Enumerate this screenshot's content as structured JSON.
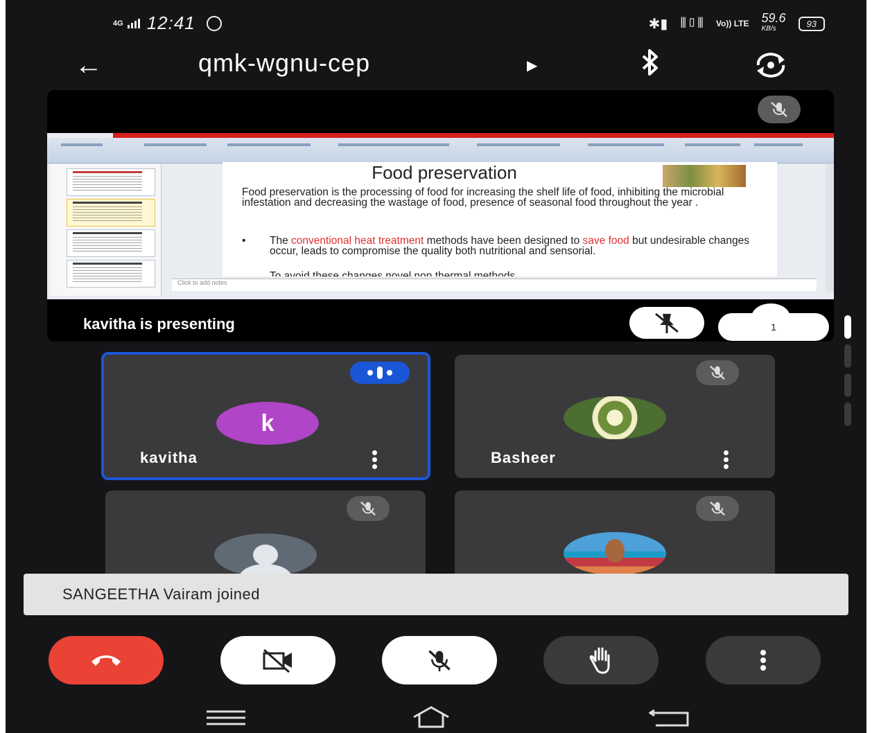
{
  "status_bar": {
    "network": "4G",
    "time": "12:41",
    "lte_label": "Vo)) LTE",
    "speed_value": "59.6",
    "speed_unit": "KB/s",
    "battery": "93"
  },
  "header": {
    "meeting_code": "qmk-wgnu-cep",
    "icons": [
      "back-arrow-icon",
      "play-arrow-icon",
      "bluetooth-icon",
      "switch-camera-icon"
    ]
  },
  "presentation": {
    "slide_title": "Food preservation",
    "slide_paragraph": "Food preservation is the processing of food for increasing the shelf life of food, inhibiting the microbial infestation and decreasing the wastage of food, presence of seasonal food throughout the year .",
    "bullet_pre": "The ",
    "bullet_hl1": "conventional heat treatment",
    "bullet_mid": " methods have been designed to ",
    "bullet_hl2": "save food",
    "bullet_post": " but undesirable changes occur, leads to compromise the quality both nutritional and sensorial.",
    "bullet_cutoff": "To avoid these changes novel non thermal methods",
    "notes_placeholder": "Click to add notes",
    "presenter_label": "kavitha is presenting",
    "participant_count": "1",
    "highlight_color": "#e23030"
  },
  "participants": [
    {
      "name": "kavitha",
      "avatar_letter": "k",
      "speaking": true
    },
    {
      "name": "Basheer",
      "avatar": "flower-photo",
      "muted": true
    },
    {
      "name": "",
      "avatar": "default-person",
      "muted": true
    },
    {
      "name": "",
      "avatar": "user-photo",
      "muted": true
    }
  ],
  "toast": {
    "message": "SANGEETHA Vairam joined"
  },
  "controls": {
    "buttons": [
      "end-call-icon",
      "camera-off-icon",
      "mic-off-icon",
      "raise-hand-icon",
      "more-options-icon"
    ],
    "end_call_color": "#ea4335",
    "speaking_color": "#1a56d6"
  },
  "system_nav": {
    "buttons": [
      "menu-icon",
      "home-icon",
      "back-icon"
    ]
  }
}
